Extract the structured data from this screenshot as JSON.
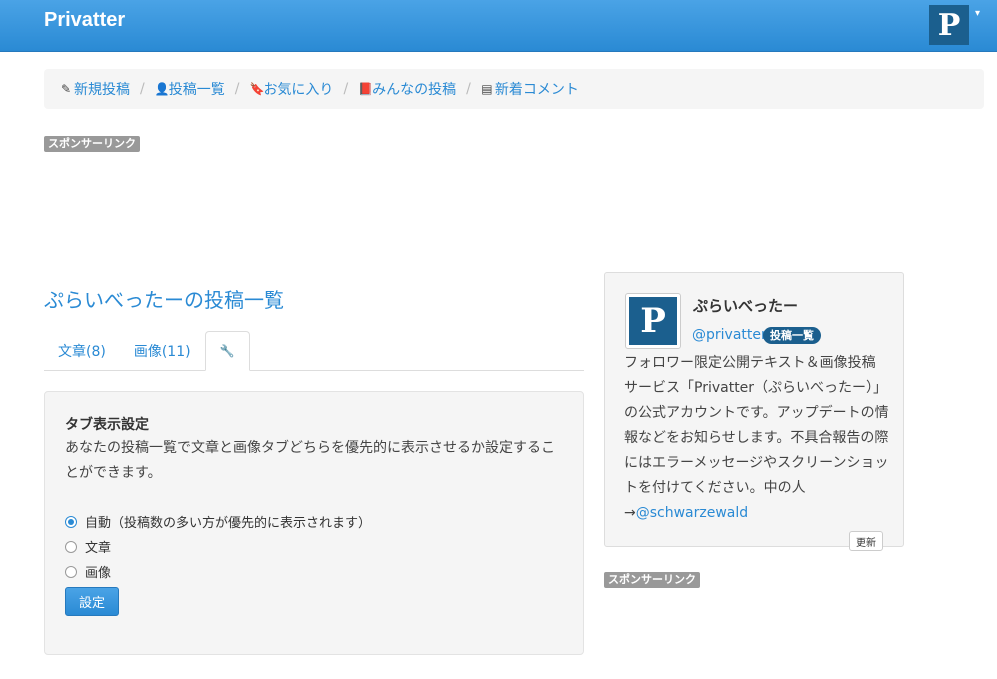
{
  "navbar": {
    "brand": "Privatter",
    "avatar_letter": "P",
    "caret": "▾"
  },
  "breadcrumb": [
    {
      "icon": "✎",
      "icon_name": "edit-icon",
      "label": "新規投稿"
    },
    {
      "icon": "👤",
      "icon_name": "user-icon",
      "label": "投稿一覧"
    },
    {
      "icon": "🔖",
      "icon_name": "bookmark-icon",
      "label": "お気に入り"
    },
    {
      "icon": "📕",
      "icon_name": "book-icon",
      "label": "みんなの投稿"
    },
    {
      "icon": "▤",
      "icon_name": "list-icon",
      "label": "新着コメント"
    }
  ],
  "breadcrumb_separator": "/",
  "sponsor_label": "スポンサーリンク",
  "page_title": "ぷらいべったーの投稿一覧",
  "tabs": [
    {
      "label": "文章(8)"
    },
    {
      "label": "画像(11)"
    },
    {
      "label": "🔧",
      "icon_name": "wrench-icon"
    }
  ],
  "settings": {
    "title": "タブ表示設定",
    "description": "あなたの投稿一覧で文章と画像タブどちらを優先的に表示させるか設定することができます。",
    "options": [
      {
        "label": "自動（投稿数の多い方が優先的に表示されます）",
        "checked": true
      },
      {
        "label": "文章",
        "checked": false
      },
      {
        "label": "画像",
        "checked": false
      }
    ],
    "submit_label": "設定"
  },
  "profile": {
    "avatar_letter": "P",
    "name": "ぷらいべったー",
    "handle": "@privatter",
    "badge": "投稿一覧",
    "bio": "フォロワー限定公開テキスト＆画像投稿サービス「Privatter（ぷらいべったー）」の公式アカウントです。アップデートの情報などをお知らせします。不具合報告の際にはエラーメッセージやスクリーンショットを付けてください。中の人→",
    "bio_link": "@schwarzewald",
    "update_label": "更新"
  },
  "colors": {
    "accent": "#2a8ad4",
    "navbar": "#3a97dd",
    "brand_dark": "#1b5f8e"
  }
}
